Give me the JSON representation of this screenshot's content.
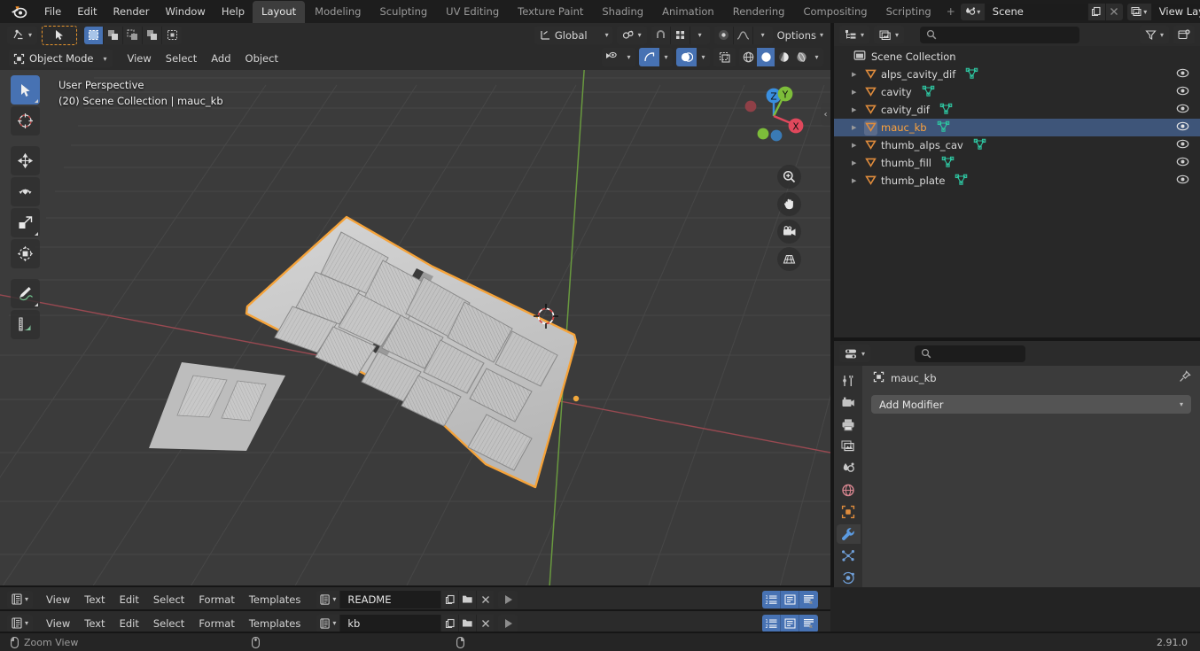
{
  "topbar": {
    "logo_icon": "blender-logo-icon",
    "menus": [
      "File",
      "Edit",
      "Render",
      "Window",
      "Help"
    ],
    "workspaces": [
      {
        "label": "Layout",
        "active": true
      },
      {
        "label": "Modeling",
        "active": false
      },
      {
        "label": "Sculpting",
        "active": false
      },
      {
        "label": "UV Editing",
        "active": false
      },
      {
        "label": "Texture Paint",
        "active": false
      },
      {
        "label": "Shading",
        "active": false
      },
      {
        "label": "Animation",
        "active": false
      },
      {
        "label": "Rendering",
        "active": false
      },
      {
        "label": "Compositing",
        "active": false
      },
      {
        "label": "Scripting",
        "active": false
      }
    ],
    "add_workspace_label": "+",
    "scene": {
      "icon": "scene-icon",
      "name": "Scene",
      "new_icon": "new-copy-icon",
      "unlink_icon": "x-icon"
    },
    "view_layer": {
      "icon": "view-layer-icon",
      "name": "View Layer",
      "new_icon": "new-copy-icon",
      "unlink_icon": "x-icon"
    }
  },
  "viewport": {
    "editor_type_icon": "editor-type-3dview-icon",
    "mode": "Object Mode",
    "menus": [
      "View",
      "Select",
      "Add",
      "Object"
    ],
    "transform_orientation": "Global",
    "options_label": "Options",
    "select_modes": [
      "select-box-icon",
      "select-extend-icon",
      "select-subtract-icon",
      "select-invert-icon",
      "select-intersect-icon"
    ],
    "overlay_text_line1": "User Perspective",
    "overlay_text_line2": "(20) Scene Collection | mauc_kb",
    "tools": [
      {
        "name": "tweak-select-tool",
        "icon": "cursor-arrow-icon",
        "active": true
      },
      {
        "name": "cursor-tool",
        "icon": "3d-cursor-icon",
        "active": false
      },
      {
        "name": "move-tool",
        "icon": "move-arrows-icon",
        "active": false
      },
      {
        "name": "rotate-tool",
        "icon": "rotate-icon",
        "active": false
      },
      {
        "name": "scale-tool",
        "icon": "scale-icon",
        "active": false
      },
      {
        "name": "transform-tool",
        "icon": "transform-icon",
        "active": false
      },
      {
        "name": "annotate-tool",
        "icon": "pencil-icon",
        "active": false
      },
      {
        "name": "measure-tool",
        "icon": "ruler-icon",
        "active": false
      }
    ],
    "gizmo_axes": [
      "X",
      "Y",
      "Z"
    ],
    "nav_buttons": [
      "zoom-icon",
      "hand-pan-icon",
      "camera-icon",
      "grid-ortho-icon"
    ],
    "shading_modes": [
      "wireframe-icon",
      "solid-icon",
      "material-preview-icon",
      "rendered-icon"
    ],
    "active_shading": "solid-icon"
  },
  "outliner": {
    "display_mode_icon": "outliner-view-layer-icon",
    "filter_id_icon": "filter-id-icon",
    "search_placeholder": "",
    "filter_icon": "funnel-icon",
    "new_collection_icon": "new-collection-icon",
    "root": {
      "label": "Scene Collection",
      "icon": "collection-icon"
    },
    "items": [
      {
        "label": "alps_cavity_dif",
        "icon": "object-mesh-icon",
        "data_icon": "mesh-data-icon",
        "visible_icon": "eye-icon",
        "selected": false
      },
      {
        "label": "cavity",
        "icon": "object-mesh-icon",
        "data_icon": "mesh-data-icon",
        "visible_icon": "eye-icon",
        "selected": false
      },
      {
        "label": "cavity_dif",
        "icon": "object-mesh-icon",
        "data_icon": "mesh-data-icon",
        "visible_icon": "eye-icon",
        "selected": false
      },
      {
        "label": "mauc_kb",
        "icon": "object-mesh-icon",
        "data_icon": "mesh-data-icon",
        "visible_icon": "eye-icon",
        "selected": true
      },
      {
        "label": "thumb_alps_cav",
        "icon": "object-mesh-icon",
        "data_icon": "mesh-data-icon",
        "visible_icon": "eye-icon",
        "selected": false
      },
      {
        "label": "thumb_fill",
        "icon": "object-mesh-icon",
        "data_icon": "mesh-data-icon",
        "visible_icon": "eye-icon",
        "selected": false
      },
      {
        "label": "thumb_plate",
        "icon": "object-mesh-icon",
        "data_icon": "mesh-data-icon",
        "visible_icon": "eye-icon",
        "selected": false
      }
    ]
  },
  "properties": {
    "editor_type_icon": "editor-type-properties-icon",
    "search_placeholder": "",
    "tabs": [
      {
        "name": "tool-tab",
        "icon": "tool-screwdriver-wrench-icon",
        "active": false
      },
      {
        "name": "render-tab",
        "icon": "render-camera-back-icon",
        "active": false
      },
      {
        "name": "output-tab",
        "icon": "output-printer-icon",
        "active": false
      },
      {
        "name": "view-layer-tab",
        "icon": "view-layer-images-icon",
        "active": false
      },
      {
        "name": "scene-tab",
        "icon": "scene-cone-icon",
        "active": false
      },
      {
        "name": "world-tab",
        "icon": "world-globe-icon",
        "active": false
      },
      {
        "name": "object-tab",
        "icon": "object-square-icon",
        "active": false
      },
      {
        "name": "modifier-tab",
        "icon": "wrench-icon",
        "active": true
      },
      {
        "name": "particles-tab",
        "icon": "particles-icon",
        "active": false
      },
      {
        "name": "physics-tab",
        "icon": "physics-orbit-icon",
        "active": false
      }
    ],
    "breadcrumb": {
      "icon": "object-icon",
      "label": "mauc_kb",
      "pin_icon": "pin-icon"
    },
    "add_modifier_label": "Add Modifier"
  },
  "text_editors": [
    {
      "editor_type_icon": "editor-type-text-icon",
      "menus": [
        "View",
        "Text",
        "Edit",
        "Select",
        "Format",
        "Templates"
      ],
      "datablock_icon": "text-datablock-icon",
      "filename": "README",
      "new_icon": "new-copy-icon",
      "open_icon": "folder-open-icon",
      "unlink_icon": "x-icon",
      "run_icon": "play-script-icon",
      "toggles": [
        "line-numbers-icon",
        "word-wrap-icon",
        "syntax-highlight-icon"
      ]
    },
    {
      "editor_type_icon": "editor-type-text-icon",
      "menus": [
        "View",
        "Text",
        "Edit",
        "Select",
        "Format",
        "Templates"
      ],
      "datablock_icon": "text-datablock-icon",
      "filename": "kb",
      "new_icon": "new-copy-icon",
      "open_icon": "folder-open-icon",
      "unlink_icon": "x-icon",
      "run_icon": "play-script-icon",
      "toggles": [
        "line-numbers-icon",
        "word-wrap-icon",
        "syntax-highlight-icon"
      ]
    }
  ],
  "status_bar": {
    "mouse_icon_1": "mouse-left-icon",
    "action_1": "Zoom View",
    "mouse_icon_2": "mouse-middle-icon",
    "mouse_icon_3": "mouse-right-icon",
    "version": "2.91.0"
  },
  "colors": {
    "accent_blue": "#4772b3",
    "select_orange": "#ffa33c",
    "outliner_select_row": "#3e5579",
    "viewport_bg": "#3b3b3b",
    "header_bg": "#2b2b2b",
    "topbar_bg": "#1d1d1d"
  }
}
